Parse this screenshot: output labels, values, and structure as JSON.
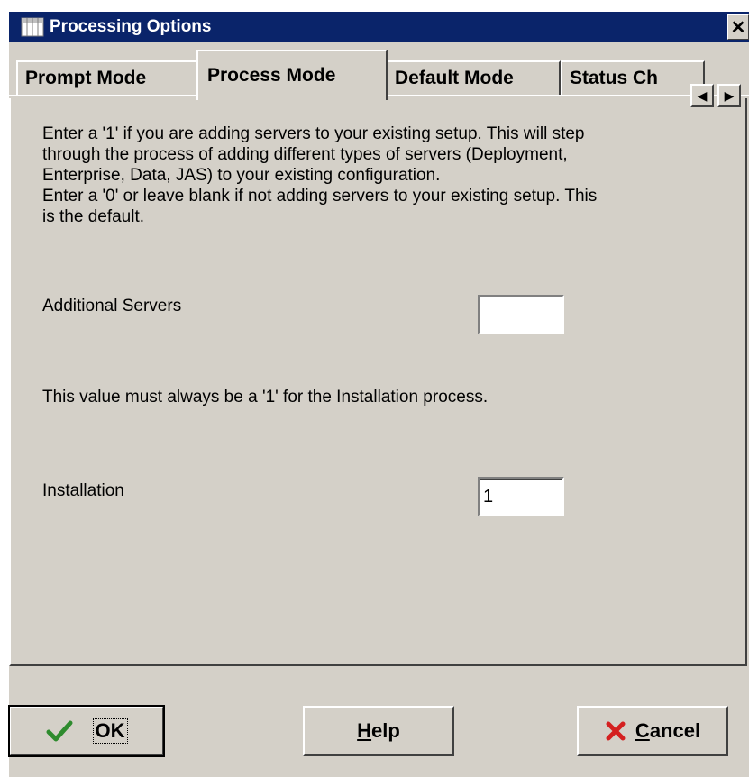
{
  "window": {
    "title": "Processing Options",
    "close_glyph": "✕"
  },
  "tabs": [
    {
      "label": "Prompt Mode",
      "active": false
    },
    {
      "label": "Process Mode",
      "active": true
    },
    {
      "label": "Default Mode",
      "active": false
    },
    {
      "label": "Status Ch",
      "active": false
    }
  ],
  "tab_scroll": {
    "left_glyph": "◀",
    "right_glyph": "▶"
  },
  "content": {
    "additional_servers": {
      "description": [
        "Enter a '1' if you are adding servers to your existing setup. This will step",
        "through the process of adding different types of servers (Deployment,",
        "Enterprise, Data, JAS) to your existing configuration.",
        "Enter a '0' or leave blank if not adding servers to your existing setup. This",
        "is the default."
      ],
      "label": "Additional Servers",
      "value": ""
    },
    "installation": {
      "description": "This value must always be a '1' for the Installation process.",
      "label": "Installation",
      "value": "1"
    }
  },
  "buttons": {
    "ok": {
      "label": "OK",
      "icon": "checkmark-icon"
    },
    "help": {
      "label_mnemonic": "H",
      "label_rest": "elp"
    },
    "cancel": {
      "label_mnemonic": "C",
      "label_rest": "ancel",
      "icon": "red-x-icon"
    }
  },
  "colors": {
    "titlebar": "#0a246a",
    "face": "#d4d0c8",
    "check_green": "#2e8b2e",
    "cancel_red": "#d42020"
  }
}
